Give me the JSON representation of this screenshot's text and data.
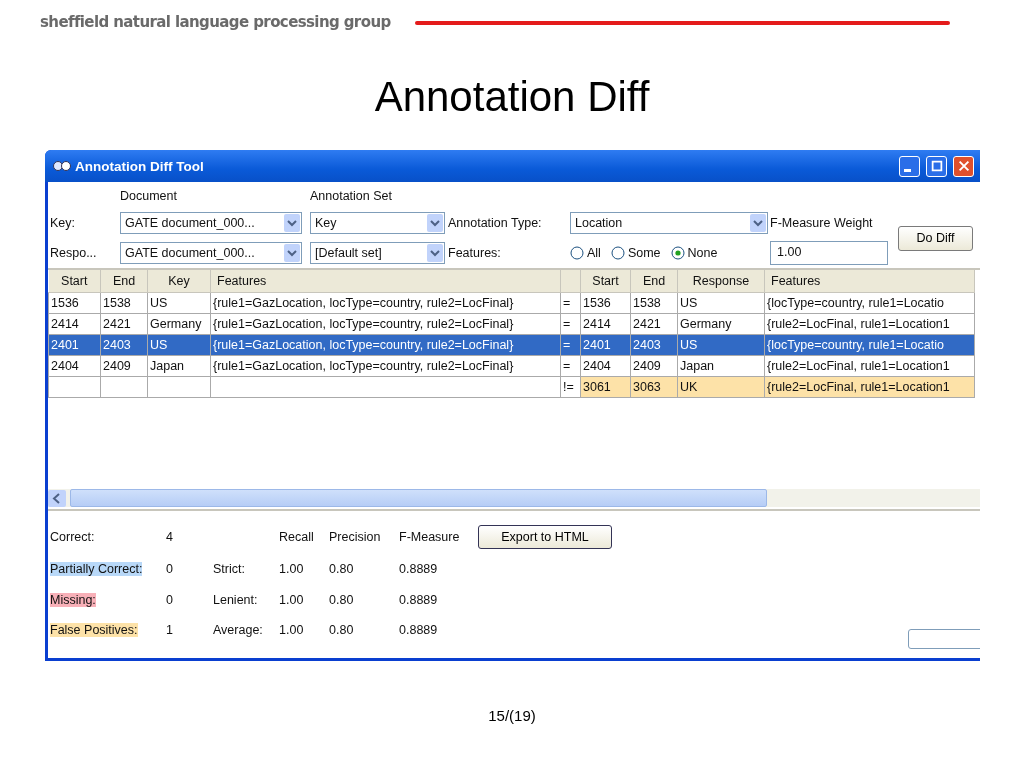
{
  "header": {
    "brand": "sheffield natural language processing group"
  },
  "slide_title": "Annotation Diff",
  "window": {
    "title": "Annotation Diff Tool"
  },
  "form": {
    "document_heading": "Document",
    "set_heading": "Annotation Set",
    "key": {
      "label": "Key:",
      "document": "GATE document_000...",
      "set": "Key"
    },
    "response": {
      "label": "Respo...",
      "document": "GATE document_000...",
      "set": "[Default set]"
    },
    "annotation_type": {
      "label": "Annotation Type:",
      "value": "Location"
    },
    "features": {
      "label": "Features:",
      "options": [
        {
          "label": "All",
          "selected": false
        },
        {
          "label": "Some",
          "selected": false
        },
        {
          "label": "None",
          "selected": true
        }
      ]
    },
    "fmeasure_weight": {
      "label": "F-Measure Weight",
      "value": "1.00"
    },
    "do_diff_button": "Do Diff"
  },
  "table": {
    "key_columns": [
      "Start",
      "End",
      "Key",
      "Features"
    ],
    "response_columns": [
      "Start",
      "End",
      "Response",
      "Features"
    ],
    "rows": [
      {
        "key": [
          "1536",
          "1538",
          "US",
          "{rule1=GazLocation, locType=country, rule2=LocFinal}"
        ],
        "match": "=",
        "response": [
          "1536",
          "1538",
          "US",
          "{locType=country, rule1=Locatio"
        ],
        "selected": false,
        "kind": "correct"
      },
      {
        "key": [
          "2414",
          "2421",
          "Germany",
          "{rule1=GazLocation, locType=country, rule2=LocFinal}"
        ],
        "match": "=",
        "response": [
          "2414",
          "2421",
          "Germany",
          "{rule2=LocFinal, rule1=Location1"
        ],
        "selected": false,
        "kind": "correct"
      },
      {
        "key": [
          "2401",
          "2403",
          "US",
          "{rule1=GazLocation, locType=country, rule2=LocFinal}"
        ],
        "match": "=",
        "response": [
          "2401",
          "2403",
          "US",
          "{locType=country, rule1=Locatio"
        ],
        "selected": true,
        "kind": "correct"
      },
      {
        "key": [
          "2404",
          "2409",
          "Japan",
          "{rule1=GazLocation, locType=country, rule2=LocFinal}"
        ],
        "match": "=",
        "response": [
          "2404",
          "2409",
          "Japan",
          "{rule2=LocFinal, rule1=Location1"
        ],
        "selected": false,
        "kind": "correct"
      },
      {
        "match": "!=",
        "response": [
          "3061",
          "3063",
          "UK",
          "{rule2=LocFinal, rule1=Location1"
        ],
        "selected": false,
        "kind": "false_positive"
      }
    ]
  },
  "stats": {
    "counts": [
      {
        "label": "Correct:",
        "value": "4"
      },
      {
        "label": "Partially Correct:",
        "value": "0",
        "color": "#b8d8f8"
      },
      {
        "label": "Missing:",
        "value": "0",
        "color": "#f8b0b8"
      },
      {
        "label": "False Positives:",
        "value": "1",
        "color": "#fde2a8"
      }
    ],
    "metric_headers": [
      "Recall",
      "Precision",
      "F-Measure"
    ],
    "metrics": [
      {
        "label": "Strict:",
        "values": [
          "1.00",
          "0.80",
          "0.8889"
        ]
      },
      {
        "label": "Lenient:",
        "values": [
          "1.00",
          "0.80",
          "0.8889"
        ]
      },
      {
        "label": "Average:",
        "values": [
          "1.00",
          "0.80",
          "0.8889"
        ]
      }
    ],
    "export_button": "Export to HTML"
  },
  "page_number": "15/(19)"
}
